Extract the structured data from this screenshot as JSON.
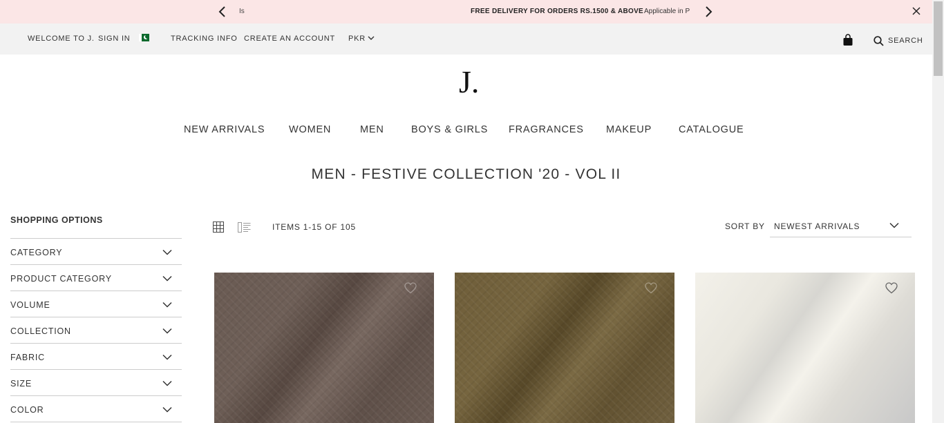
{
  "promo": {
    "prev_message": "Is",
    "message": "FREE DELIVERY FOR ORDERS RS.1500 & ABOVE",
    "sub": "Applicable in P"
  },
  "utility": {
    "welcome": "WELCOME TO J.",
    "sign_in": "SIGN IN",
    "tracking": "TRACKING INFO",
    "create_account": "CREATE AN ACCOUNT",
    "currency": "PKR",
    "search": "SEARCH"
  },
  "logo": "J.",
  "nav": [
    "NEW ARRIVALS",
    "WOMEN",
    "MEN",
    "BOYS & GIRLS",
    "FRAGRANCES",
    "MAKEUP",
    "CATALOGUE"
  ],
  "page_title": "MEN - FESTIVE COLLECTION '20 - VOL II",
  "sidebar": {
    "title": "SHOPPING OPTIONS",
    "filters": [
      "CATEGORY",
      "PRODUCT CATEGORY",
      "VOLUME",
      "COLLECTION",
      "FABRIC",
      "SIZE",
      "COLOR"
    ]
  },
  "toolbar": {
    "items_count": "ITEMS 1-15 OF 105",
    "sort_label": "SORT BY",
    "sort_value": "NEWEST ARRIVALS"
  },
  "products": [
    {
      "color": "#6a5b53"
    },
    {
      "color": "#6f5e3a"
    },
    {
      "color": "#ecebe4"
    }
  ]
}
